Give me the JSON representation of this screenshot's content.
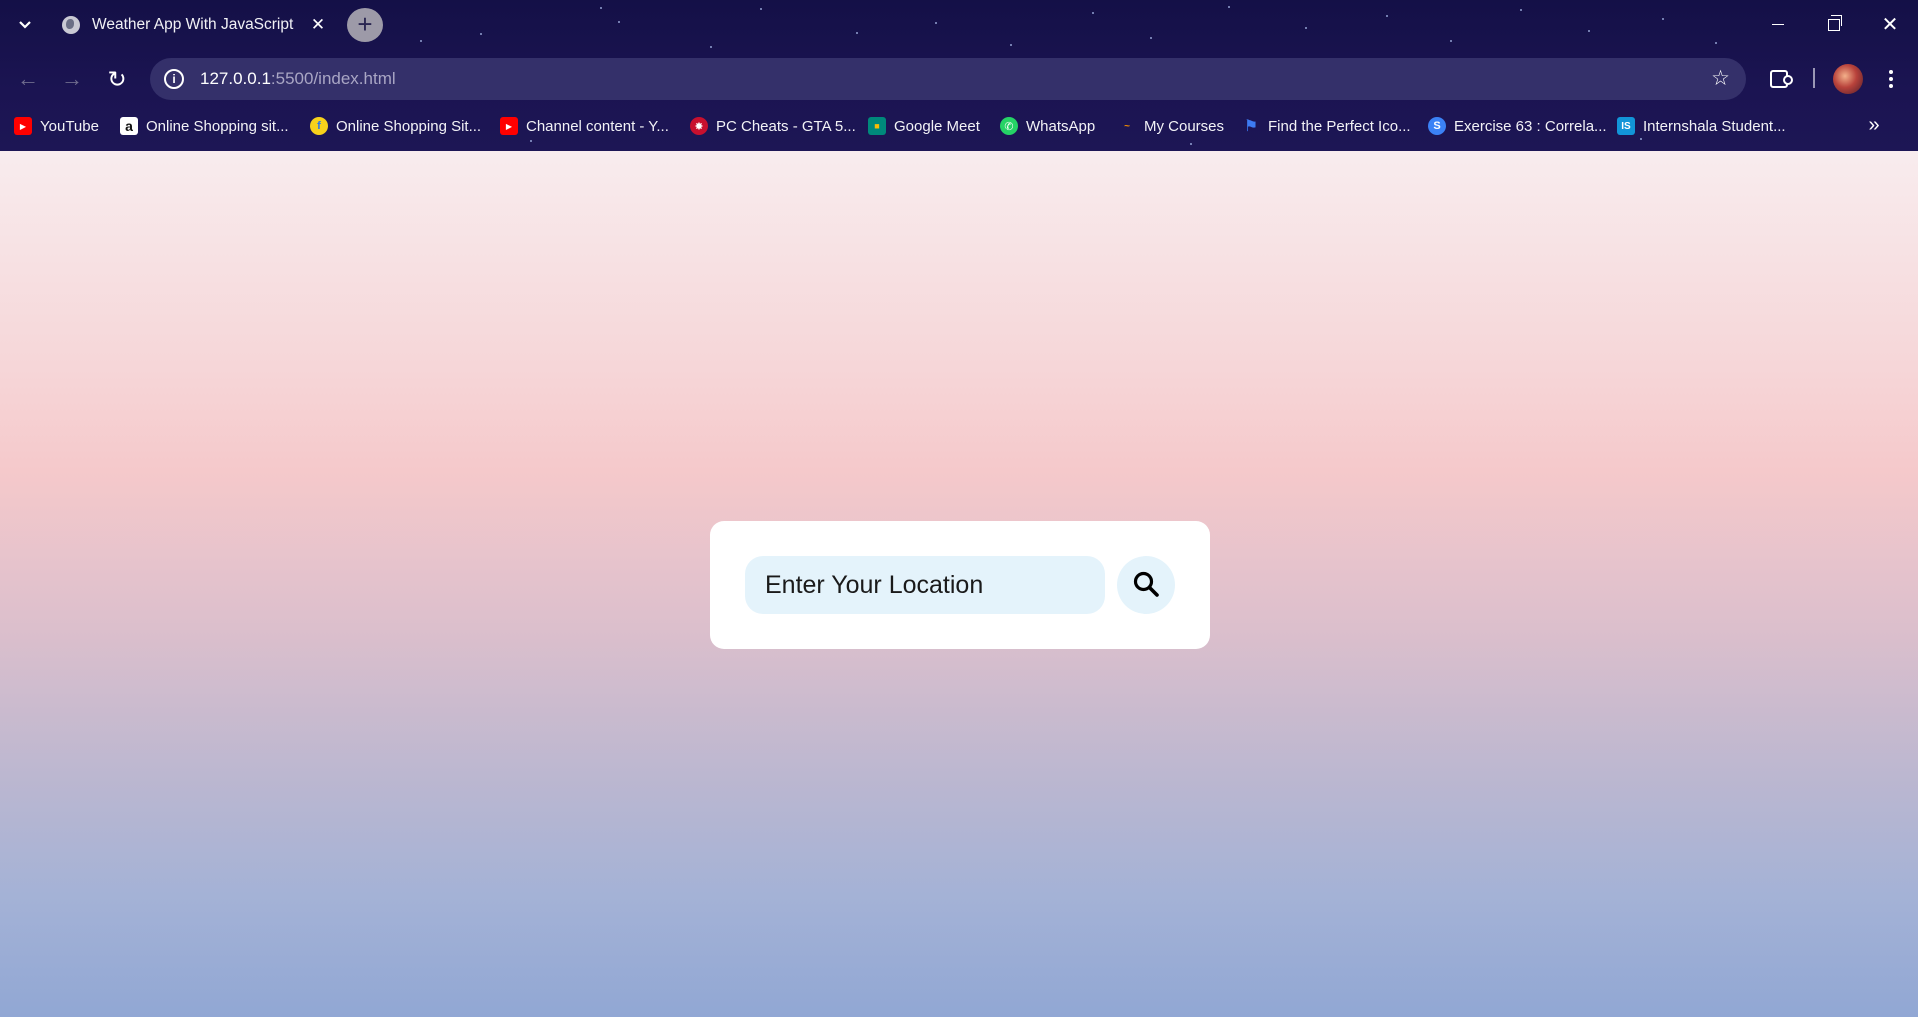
{
  "tab": {
    "title": "Weather App With JavaScript",
    "close_glyph": "✕",
    "icon": "globe-icon"
  },
  "newtab_glyph": "+",
  "window_controls": {
    "close_glyph": "✕"
  },
  "toolbar": {
    "back_glyph": "←",
    "forward_glyph": "→",
    "reload_glyph": "↻",
    "url_host": "127.0.0.1",
    "url_rest": ":5500/index.html",
    "bookmark_star_glyph": "☆"
  },
  "bookmarks": [
    {
      "label": "YouTube",
      "icon": "youtube-icon",
      "color": "#ff0000",
      "glyph": "▶"
    },
    {
      "label": "Online Shopping sit...",
      "icon": "amazon-icon",
      "color": "#ffffff",
      "glyph": "a"
    },
    {
      "label": "Online Shopping Sit...",
      "icon": "flipkart-icon",
      "color": "#f7d11b",
      "glyph": "f"
    },
    {
      "label": "Channel content - Y...",
      "icon": "youtube-studio-icon",
      "color": "#ff0000",
      "glyph": "▶"
    },
    {
      "label": "PC Cheats - GTA 5...",
      "icon": "gta-cheats-icon",
      "color": "#c8102e",
      "glyph": "✸"
    },
    {
      "label": "Google Meet",
      "icon": "google-meet-icon",
      "color": "#00897b",
      "glyph": "■"
    },
    {
      "label": "WhatsApp",
      "icon": "whatsapp-icon",
      "color": "#25d366",
      "glyph": "✆"
    },
    {
      "label": "My Courses",
      "icon": "courses-icon",
      "color": "#f08a00",
      "glyph": "~"
    },
    {
      "label": "Find the Perfect Ico...",
      "icon": "flag-icon",
      "color": "#3d7bf2",
      "glyph": "⚑"
    },
    {
      "label": "Exercise 63 : Correla...",
      "icon": "exercise-site-icon",
      "color": "#3b82f6",
      "glyph": "S"
    },
    {
      "label": "Internshala Student...",
      "icon": "internshala-icon",
      "color": "#1295d8",
      "glyph": "IS"
    }
  ],
  "bookmarks_more_glyph": "»",
  "search": {
    "placeholder": "Enter Your Location",
    "value": ""
  }
}
